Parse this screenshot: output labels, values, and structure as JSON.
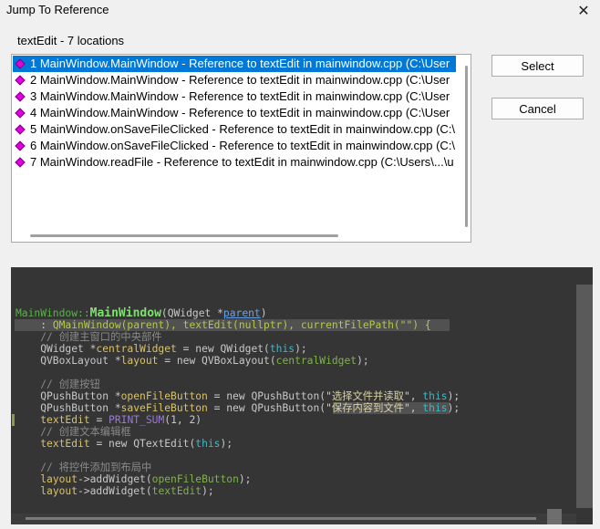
{
  "window": {
    "title": "Jump To Reference",
    "close_glyph": "✕"
  },
  "locations_label": "textEdit - 7 locations",
  "list": {
    "selected_index": 0,
    "items": [
      "1 MainWindow.MainWindow - Reference to textEdit in mainwindow.cpp (C:\\User",
      "2 MainWindow.MainWindow - Reference to textEdit in mainwindow.cpp (C:\\User",
      "3 MainWindow.MainWindow - Reference to textEdit in mainwindow.cpp (C:\\User",
      "4 MainWindow.MainWindow - Reference to textEdit in mainwindow.cpp (C:\\User",
      "5 MainWindow.onSaveFileClicked - Reference to textEdit in mainwindow.cpp (C:\\",
      "6 MainWindow.onSaveFileClicked - Reference to textEdit in mainwindow.cpp (C:\\",
      "7 MainWindow.readFile - Reference to textEdit in mainwindow.cpp (C:\\Users\\...\\u"
    ]
  },
  "buttons": {
    "select": "Select",
    "cancel": "Cancel"
  },
  "code": [
    [
      {
        "t": "MainWindow::",
        "c": "#5ab44a"
      },
      {
        "t": "MainWindow",
        "c": "#7fe06f",
        "b": true
      },
      {
        "t": "(QWidget *"
      },
      {
        "t": "parent",
        "c": "#6aa2e6",
        "u": true
      },
      {
        "t": ")"
      }
    ],
    [
      {
        "t": "    : "
      },
      {
        "t": "QMainWindow(parent), textEdit(nullptr), currentFilePath(\"\") {",
        "c": "#b5c84a"
      }
    ],
    [
      {
        "t": "    // 创建主窗口的中央部件",
        "c": "#8a8a8a"
      }
    ],
    [
      {
        "t": "    QWidget *"
      },
      {
        "t": "centralWidget",
        "c": "#d9c26b"
      },
      {
        "t": " = new QWidget("
      },
      {
        "t": "this",
        "c": "#3fb8c8"
      },
      {
        "t": ");"
      }
    ],
    [
      {
        "t": "    QVBoxLayout *"
      },
      {
        "t": "layout",
        "c": "#d9c26b"
      },
      {
        "t": " = new QVBoxLayout("
      },
      {
        "t": "centralWidget",
        "c": "#7fb34a"
      },
      {
        "t": ");"
      }
    ],
    [],
    [
      {
        "t": "    // 创建按钮",
        "c": "#8a8a8a"
      }
    ],
    [
      {
        "t": "    QPushButton *"
      },
      {
        "t": "openFileButton",
        "c": "#d9c26b"
      },
      {
        "t": " = new QPushButton("
      },
      {
        "t": "\"选择文件并读取\"",
        "c": "#d9d2a6"
      },
      {
        "t": ", "
      },
      {
        "t": "this",
        "c": "#3fb8c8"
      },
      {
        "t": ");"
      }
    ],
    [
      {
        "t": "    QPushButton *"
      },
      {
        "t": "saveFileButton",
        "c": "#d9c26b"
      },
      {
        "t": " = new QPushButton("
      },
      {
        "t": "\"保存内容到文件\"",
        "c": "#d9d2a6"
      },
      {
        "t": ", "
      },
      {
        "t": "this",
        "c": "#3fb8c8"
      },
      {
        "t": ");"
      }
    ],
    [
      {
        "t": "    "
      },
      {
        "t": "textEdit",
        "c": "#d9c26b"
      },
      {
        "t": " = "
      },
      {
        "t": "PRINT_SUM",
        "c": "#9c7ad0"
      },
      {
        "t": "(1, 2)"
      }
    ],
    [
      {
        "t": "    // 创建文本编辑框",
        "c": "#8a8a8a"
      }
    ],
    [
      {
        "t": "    "
      },
      {
        "t": "textEdit",
        "c": "#d9c26b"
      },
      {
        "t": " = new QTextEdit("
      },
      {
        "t": "this",
        "c": "#3fb8c8"
      },
      {
        "t": ");"
      }
    ],
    [],
    [
      {
        "t": "    // 将控件添加到布局中",
        "c": "#8a8a8a"
      }
    ],
    [
      {
        "t": "    "
      },
      {
        "t": "layout",
        "c": "#d9c26b"
      },
      {
        "t": "->addWidget("
      },
      {
        "t": "openFileButton",
        "c": "#7fb34a"
      },
      {
        "t": ");"
      }
    ],
    [
      {
        "t": "    "
      },
      {
        "t": "layout",
        "c": "#d9c26b"
      },
      {
        "t": "->addWidget("
      },
      {
        "t": "textEdit",
        "c": "#7fb34a"
      },
      {
        "t": ");"
      }
    ]
  ]
}
